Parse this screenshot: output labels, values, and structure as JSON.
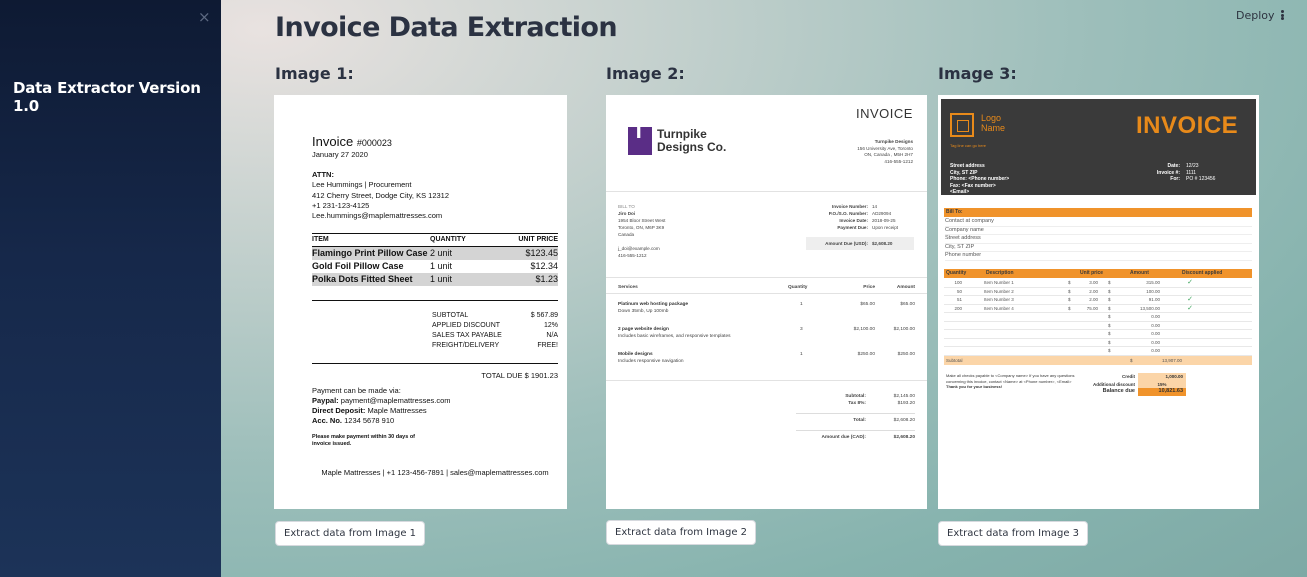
{
  "sidebar": {
    "title": "Data Extractor Version 1.0",
    "close_glyph": "×"
  },
  "topbar": {
    "deploy_label": "Deploy",
    "menu_icon": "vertical-dots-icon"
  },
  "page": {
    "title": "Invoice Data Extraction"
  },
  "columns": [
    {
      "heading": "Image 1:",
      "button": "Extract data from Image 1"
    },
    {
      "heading": "Image 2:",
      "button": "Extract data from Image 2"
    },
    {
      "heading": "Image 3:",
      "button": "Extract data from Image 3"
    }
  ],
  "invoice1": {
    "title": "Invoice",
    "number": "#000023",
    "date": "January 27 2020",
    "attn_label": "ATTN:",
    "attn_lines": [
      "Lee Hummings | Procurement",
      "412 Cherry Street, Dodge City, KS 12312",
      "+1 231-123-4125",
      "Lee.hummings@maplemattresses.com"
    ],
    "headers": [
      "ITEM",
      "QUANTITY",
      "UNIT PRICE"
    ],
    "items": [
      {
        "name": "Flamingo Print Pillow Case",
        "qty": "2 unit",
        "price": "$123.45"
      },
      {
        "name": "Gold Foil Pillow Case",
        "qty": "1 unit",
        "price": "$12.34"
      },
      {
        "name": "Polka Dots Fitted Sheet",
        "qty": "1 unit",
        "price": "$1.23"
      }
    ],
    "summary": [
      {
        "label": "SUBTOTAL",
        "value": "$ 567.89"
      },
      {
        "label": "APPLIED DISCOUNT",
        "value": "12%"
      },
      {
        "label": "SALES TAX PAYABLE",
        "value": "N/A"
      },
      {
        "label": "FREIGHT/DELIVERY",
        "value": "FREE!"
      }
    ],
    "total_due": "TOTAL DUE $ 1901.23",
    "payment_intro": "Payment can be made via:",
    "paypal_label": "Paypal:",
    "paypal_value": "payment@maplemattresses.com",
    "deposit_label": "Direct Deposit:",
    "deposit_value": "Maple Mattresses",
    "acc_label": "Acc. No.",
    "acc_value": "1234 5678 910",
    "note": "Please make payment within 30 days of invoice issued.",
    "footer": "Maple Mattresses | +1 123-456-7891 | sales@maplemattresses.com"
  },
  "invoice2": {
    "title": "INVOICE",
    "company_line1": "Turnpike",
    "company_line2": "Designs Co.",
    "address": [
      "Turnpike Designs",
      "156 University Ave, Toronto",
      "ON, Canada , M5H 2H7",
      "",
      "416-555-1212"
    ],
    "bill_to": [
      "BILL TO",
      "Jiro Doi",
      "1954 Bloor Street West",
      "Toronto, ON, M6P 3K9",
      "Canada",
      "",
      "j_doi@example.com",
      "416-555-1212"
    ],
    "meta": [
      {
        "label": "Invoice Number:",
        "value": "14"
      },
      {
        "label": "P.O./S.O. Number:",
        "value": "AD29094"
      },
      {
        "label": "Invoice Date:",
        "value": "2018-09-25"
      },
      {
        "label": "Payment Due:",
        "value": "Upon receipt"
      }
    ],
    "amount_due_label": "Amount Due (USD):",
    "amount_due_value": "$2,608.20",
    "headers": [
      "Services",
      "Quantity",
      "Price",
      "Amount"
    ],
    "services": [
      {
        "name": "Platinum web hosting package",
        "desc": "Down 35mb, Up 100mb",
        "qty": "1",
        "price": "$65.00",
        "amount": "$65.00"
      },
      {
        "name": "2 page website design",
        "desc": "Includes basic wireframes, and responsive templates",
        "qty": "3",
        "price": "$2,100.00",
        "amount": "$2,100.00"
      },
      {
        "name": "Mobile designs",
        "desc": "Includes responsive navigation",
        "qty": "1",
        "price": "$250.00",
        "amount": "$250.00"
      }
    ],
    "totals": [
      {
        "label": "Subtotal:",
        "value": "$2,145.00"
      },
      {
        "label": "Tax 8%:",
        "value": "$193.20"
      },
      {
        "label": "Total:",
        "value": "$2,608.20"
      },
      {
        "label": "Amount due (CAD):",
        "value": "$2,608.20"
      }
    ]
  },
  "invoice3": {
    "logo_line1": "Logo",
    "logo_line2": "Name",
    "tagline": "Tag line can go here",
    "title": "INVOICE",
    "address": [
      "Street address",
      "City, ST ZIP",
      "Phone: <Phone number>",
      "Fax: <Fax number>",
      "<Email>"
    ],
    "meta": [
      {
        "label": "Date:",
        "value": "12/23"
      },
      {
        "label": "Invoice #:",
        "value": "1111"
      },
      {
        "label": "For:",
        "value": "PO # 123456"
      }
    ],
    "bill_to_label": "Bill To:",
    "bill_to": [
      "Contact at company",
      "Company name",
      "Street address",
      "City, ST ZIP",
      "Phone number"
    ],
    "headers": [
      "Quantity",
      "Description",
      "Unit price",
      "Amount",
      "Discount applied"
    ],
    "rows": [
      {
        "qty": "100",
        "desc": "Item Number 1",
        "unit": "3.00",
        "amount": "315.00",
        "disc": "✓"
      },
      {
        "qty": "50",
        "desc": "Item Number 2",
        "unit": "2.00",
        "amount": "100.00",
        "disc": ""
      },
      {
        "qty": "51",
        "desc": "Item Number 3",
        "unit": "2.00",
        "amount": "91.00",
        "disc": "✓"
      },
      {
        "qty": "200",
        "desc": "Item Number 4",
        "unit": "75.00",
        "amount": "13,500.00",
        "disc": "✓"
      },
      {
        "qty": "",
        "desc": "",
        "unit": "",
        "amount": "0.00",
        "disc": ""
      },
      {
        "qty": "",
        "desc": "",
        "unit": "",
        "amount": "0.00",
        "disc": ""
      },
      {
        "qty": "",
        "desc": "",
        "unit": "",
        "amount": "0.00",
        "disc": ""
      },
      {
        "qty": "",
        "desc": "",
        "unit": "",
        "amount": "0.00",
        "disc": ""
      },
      {
        "qty": "",
        "desc": "",
        "unit": "",
        "amount": "0.00",
        "disc": ""
      }
    ],
    "subtotal_label": "Subtotal",
    "subtotal_value": "13,907.00",
    "note": "Make all checks payable to <Company name> If you have any questions concerning this invoice, contact <Name> at <Phone number>, <Email>",
    "thanks": "Thank you for your business!",
    "credit_label": "Credit",
    "credit_value": "1,000.00",
    "discount_label": "Additional discount",
    "discount_value": "15%",
    "balance_label": "Balance due",
    "balance_value": "10,821.63",
    "dollar": "$",
    "colors": {
      "orange": "#f0932b",
      "dark": "#3a3a3a"
    }
  }
}
